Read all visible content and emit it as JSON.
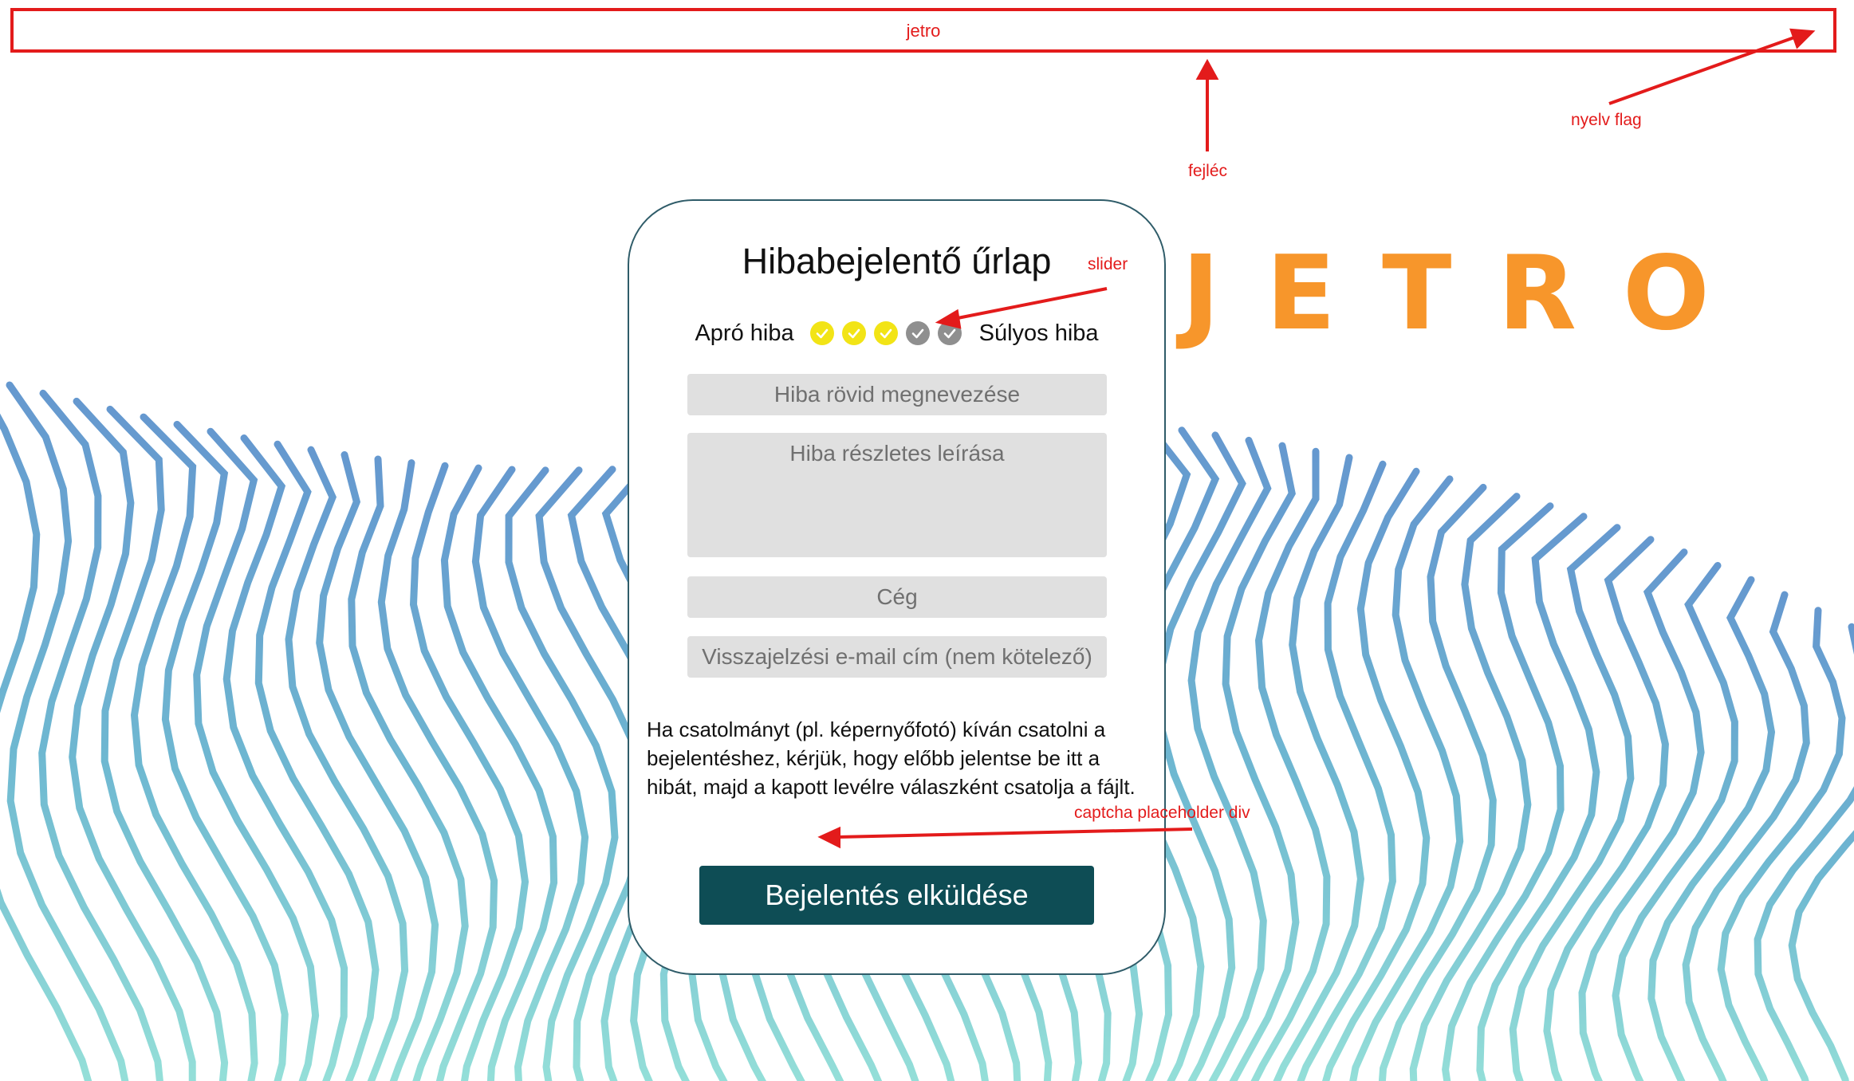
{
  "header": {
    "label": "jetro"
  },
  "annotations": {
    "header": "fejléc",
    "language": "nyelv flag",
    "slider": "slider",
    "captcha": "captcha placeholder div"
  },
  "logo": {
    "text": "JETRO",
    "color": "#f7962b"
  },
  "form": {
    "title": "Hibabejelentő űrlap",
    "severity": {
      "min_label": "Apró hiba",
      "max_label": "Súlyos hiba",
      "levels": 5,
      "selected": 3,
      "active_color": "#f2e416",
      "inactive_color": "#8f8f8f"
    },
    "fields": {
      "title_placeholder": "Hiba rövid megnevezése",
      "description_placeholder": "Hiba részletes leírása",
      "company_placeholder": "Cég",
      "email_placeholder": "Visszajelzési e-mail cím (nem kötelező)"
    },
    "info_text": "Ha csatolmányt (pl. képernyőfotó) kíván csatolni a bejelentéshez, kérjük, hogy előbb jelentse be itt a hibát, majd a kapott levélre válaszként csatolja a fájlt.",
    "submit_label": "Bejelentés elküldése",
    "submit_color": "#0e4d55"
  },
  "colors": {
    "annotation": "#e31b1b",
    "card_border": "#2f5c69"
  }
}
